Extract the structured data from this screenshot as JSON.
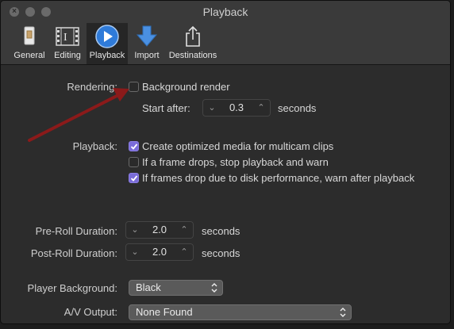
{
  "window": {
    "title": "Playback"
  },
  "toolbar": {
    "tabs": [
      {
        "label": "General",
        "icon": "general-switch-icon"
      },
      {
        "label": "Editing",
        "icon": "film-strip-icon"
      },
      {
        "label": "Playback",
        "icon": "play-circle-icon",
        "active": true
      },
      {
        "label": "Import",
        "icon": "down-arrow-icon"
      },
      {
        "label": "Destinations",
        "icon": "share-icon"
      }
    ]
  },
  "rendering": {
    "label": "Rendering:",
    "background_render": {
      "label": "Background render",
      "checked": false
    },
    "start_after": {
      "label": "Start after:",
      "value": "0.3",
      "unit": "seconds"
    }
  },
  "playback": {
    "label": "Playback:",
    "options": [
      {
        "label": "Create optimized media for multicam clips",
        "checked": true
      },
      {
        "label": "If a frame drops, stop playback and warn",
        "checked": false
      },
      {
        "label": "If frames drop due to disk performance, warn after playback",
        "checked": true
      }
    ]
  },
  "preroll": {
    "label": "Pre-Roll Duration:",
    "value": "2.0",
    "unit": "seconds"
  },
  "postroll": {
    "label": "Post-Roll Duration:",
    "value": "2.0",
    "unit": "seconds"
  },
  "player_background": {
    "label": "Player Background:",
    "value": "Black"
  },
  "av_output": {
    "label": "A/V Output:",
    "value": "None Found"
  },
  "colors": {
    "checkbox_checked": "#7a6cd8",
    "annotation_arrow": "#8b1a1a",
    "active_tab_icon": "#2f7bd9"
  }
}
